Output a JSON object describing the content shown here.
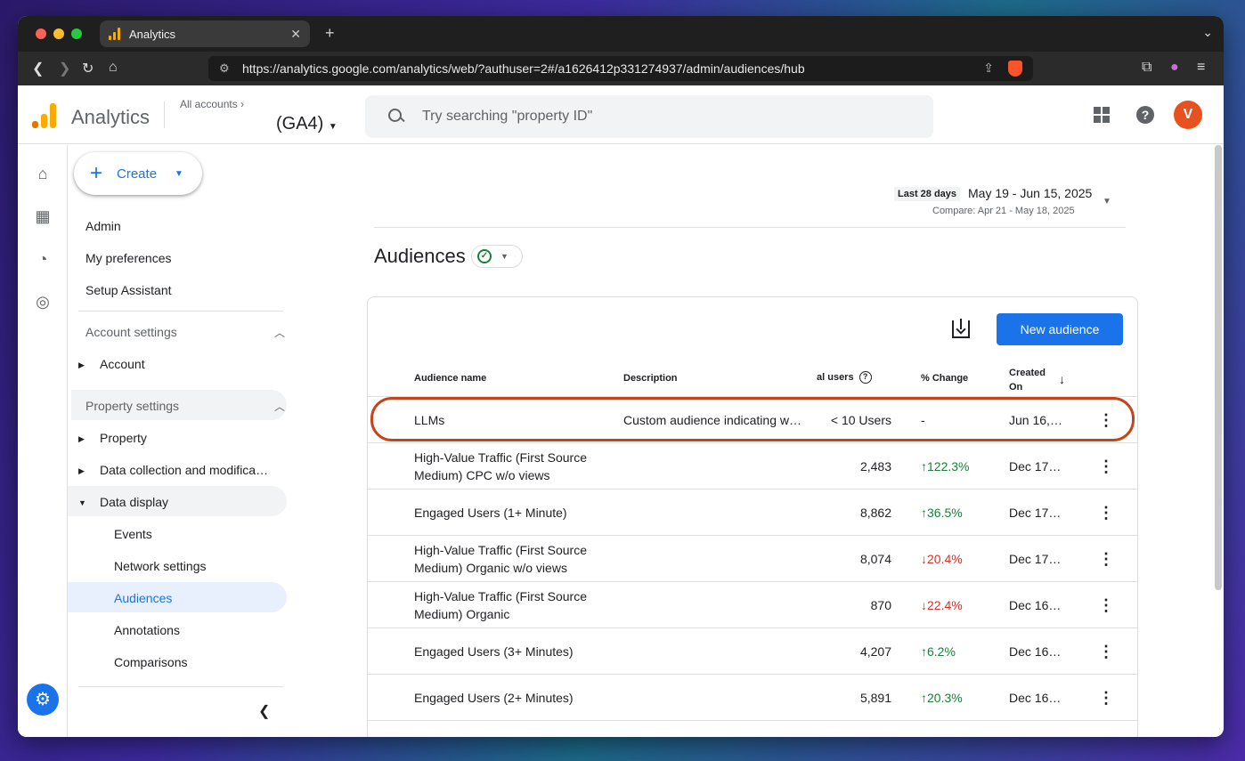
{
  "browser": {
    "tab_title": "Analytics",
    "tab_close": "✕",
    "new_tab": "+",
    "url": "https://analytics.google.com/analytics/web/?authuser=2#/a1626412p331274937/admin/audiences/hub"
  },
  "header": {
    "app_name": "Analytics",
    "all_accounts": "All accounts",
    "property": "(GA4)",
    "search_placeholder": "Try searching \"property ID\""
  },
  "sidebar": {
    "create_label": "Create",
    "items": [
      "Admin",
      "My preferences",
      "Setup Assistant"
    ],
    "account_settings": "Account settings",
    "account": "Account",
    "property_settings": "Property settings",
    "property": "Property",
    "data_collection": "Data collection and modifica…",
    "data_display": "Data display",
    "sub_items": [
      "Events",
      "Network settings",
      "Audiences",
      "Annotations",
      "Comparisons"
    ]
  },
  "date": {
    "label": "Last 28 days",
    "range": "May 19 - Jun 15, 2025",
    "compare": "Compare: Apr 21 - May 18, 2025"
  },
  "page": {
    "title": "Audiences",
    "new_audience": "New audience"
  },
  "table": {
    "headers": {
      "name": "Audience name",
      "description": "Description",
      "users": "al users",
      "change": "% Change",
      "created": "Created On"
    },
    "rows": [
      {
        "name": "LLMs",
        "description": "Custom audience indicating w…",
        "users": "< 10 Users",
        "change": "-",
        "dir": "none",
        "created": "Jun 16, …"
      },
      {
        "name": "High-Value Traffic (First Source Medium) CPC w/o views",
        "description": "",
        "users": "2,483",
        "change": "122.3%",
        "dir": "up",
        "created": "Dec 17, …"
      },
      {
        "name": "Engaged Users (1+ Minute)",
        "description": "",
        "users": "8,862",
        "change": "36.5%",
        "dir": "up",
        "created": "Dec 17, …"
      },
      {
        "name": "High-Value Traffic (First Source Medium) Organic w/o views",
        "description": "",
        "users": "8,074",
        "change": "20.4%",
        "dir": "down",
        "created": "Dec 17, …"
      },
      {
        "name": "High-Value Traffic (First Source Medium) Organic",
        "description": "",
        "users": "870",
        "change": "22.4%",
        "dir": "down",
        "created": "Dec 16, …"
      },
      {
        "name": "Engaged Users (3+ Minutes)",
        "description": "",
        "users": "4,207",
        "change": "6.2%",
        "dir": "up",
        "created": "Dec 16, …"
      },
      {
        "name": "Engaged Users (2+ Minutes)",
        "description": "",
        "users": "5,891",
        "change": "20.3%",
        "dir": "up",
        "created": "Dec 16, …"
      }
    ]
  },
  "colors": {
    "accent": "#1a73e8",
    "up": "#188038",
    "down": "#d93025",
    "highlight": "#c4441b"
  }
}
